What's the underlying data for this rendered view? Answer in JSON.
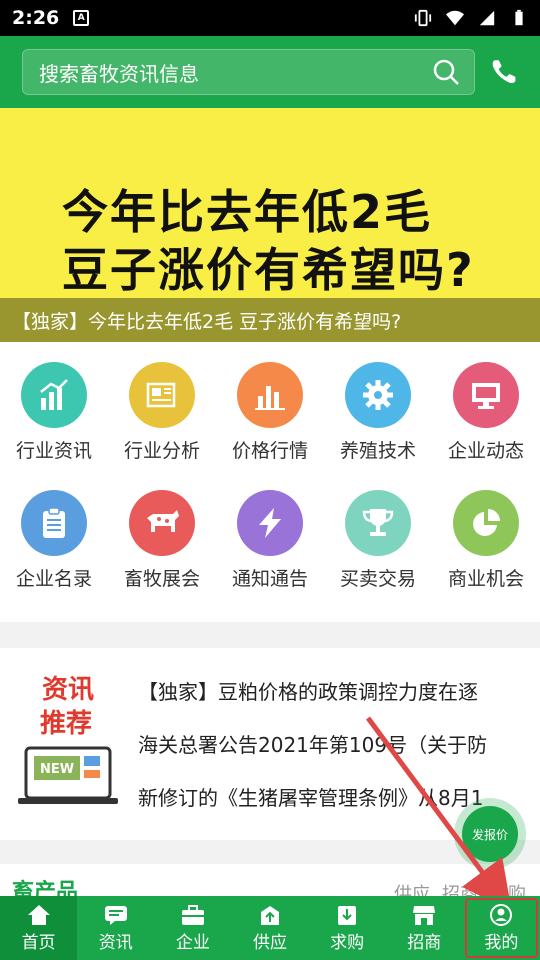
{
  "status_bar": {
    "time": "2:26",
    "notif_badge": "A"
  },
  "search": {
    "placeholder": "搜索畜牧资讯信息"
  },
  "banner": {
    "line1": "今年比去年低2毛",
    "line2": "豆子涨价有希望吗?",
    "caption": "【独家】今年比去年低2毛 豆子涨价有希望吗?"
  },
  "categories": [
    {
      "label": "行业资讯",
      "color": "#3ec7b0",
      "icon": "bar-chart-up-icon"
    },
    {
      "label": "行业分析",
      "color": "#e9c23c",
      "icon": "newspaper-icon"
    },
    {
      "label": "价格行情",
      "color": "#f5894a",
      "icon": "bar-chart-icon"
    },
    {
      "label": "养殖技术",
      "color": "#4fb6e8",
      "icon": "gear-icon"
    },
    {
      "label": "企业动态",
      "color": "#e55c7a",
      "icon": "monitor-icon"
    },
    {
      "label": "企业名录",
      "color": "#5b9ee0",
      "icon": "clipboard-icon"
    },
    {
      "label": "畜牧展会",
      "color": "#e95a5a",
      "icon": "cow-icon"
    },
    {
      "label": "通知通告",
      "color": "#9a73d8",
      "icon": "lightning-icon"
    },
    {
      "label": "买卖交易",
      "color": "#7fd4c0",
      "icon": "trophy-icon"
    },
    {
      "label": "商业机会",
      "color": "#8fc65a",
      "icon": "pie-chart-icon"
    }
  ],
  "news": {
    "art_text1": "资讯",
    "art_text2": "推荐",
    "art_badge": "NEW",
    "items": [
      "【独家】豆粕价格的政策调控力度在逐",
      "海关总署公告2021年第109号（关于防",
      "新修订的《生猪屠宰管理条例》从8月1"
    ]
  },
  "livestock": {
    "title": "畜产品",
    "tabs": [
      "供应",
      "招商",
      "求购"
    ]
  },
  "fab": {
    "label": "发报价"
  },
  "bottom_nav": [
    {
      "label": "首页",
      "icon": "home-icon"
    },
    {
      "label": "资讯",
      "icon": "message-icon"
    },
    {
      "label": "企业",
      "icon": "briefcase-icon"
    },
    {
      "label": "供应",
      "icon": "upload-box-icon"
    },
    {
      "label": "求购",
      "icon": "download-box-icon"
    },
    {
      "label": "招商",
      "icon": "store-icon"
    },
    {
      "label": "我的",
      "icon": "user-icon"
    }
  ],
  "colors": {
    "primary": "#1aa64a",
    "banner": "#f9ee45",
    "arrow": "#e04848"
  }
}
